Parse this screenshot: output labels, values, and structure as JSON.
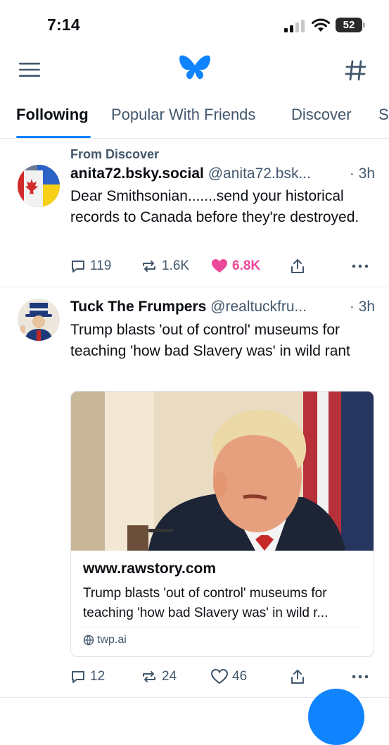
{
  "status_bar": {
    "time": "7:14",
    "battery": "52"
  },
  "tabs": [
    {
      "label": "Following",
      "active": true
    },
    {
      "label": "Popular With Friends",
      "active": false
    },
    {
      "label": "Discover",
      "active": false
    },
    {
      "label": "S",
      "active": false
    }
  ],
  "posts": [
    {
      "context": "From Discover",
      "author_name": "anita72.bsky.social",
      "author_handle": "@anita72.bsk...",
      "time": "· 3h",
      "text": "Dear Smithsonian.......send your historical records to Canada before they're destroyed.",
      "replies": "119",
      "reposts": "1.6K",
      "likes": "6.8K",
      "liked": true
    },
    {
      "author_name": "Tuck The Frumpers",
      "author_handle": "@realtuckfru...",
      "time": "· 3h",
      "text": "Trump blasts 'out of control' museums for teaching 'how bad Slavery was' in wild rant",
      "replies": "12",
      "reposts": "24",
      "likes": "46",
      "liked": false,
      "card": {
        "domain": "www.rawstory.com",
        "title": "Trump blasts 'out of control' museums for teaching 'how bad Slavery was' in wild r...",
        "source": "twp.ai"
      }
    }
  ],
  "colors": {
    "accent": "#1083fe",
    "like": "#ec4899",
    "muted_text": "#42576c",
    "divider": "#e6e9ee"
  },
  "icons": [
    "menu-icon",
    "butterfly-logo-icon",
    "hashtag-icon",
    "reply-icon",
    "repost-icon",
    "like-icon",
    "share-icon",
    "more-icon",
    "globe-icon"
  ]
}
